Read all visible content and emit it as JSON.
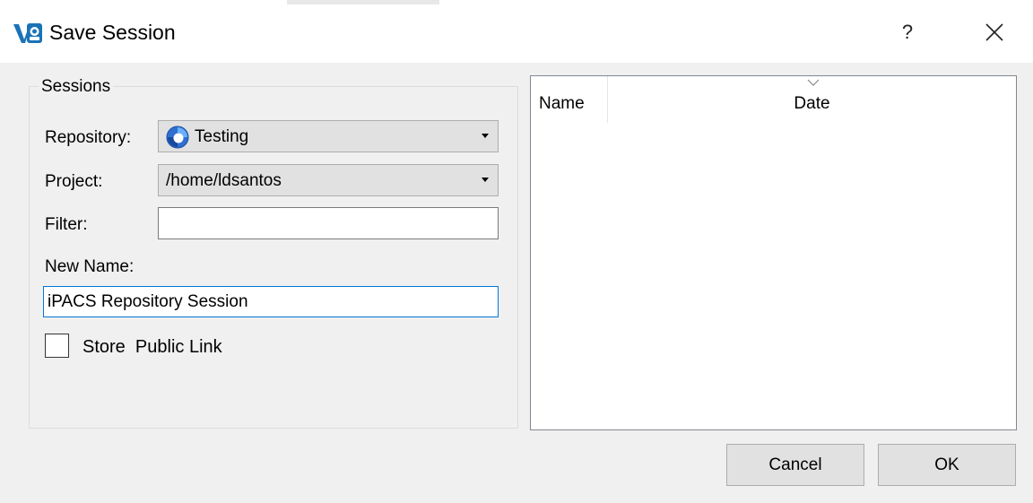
{
  "window": {
    "title": "Save Session",
    "help_label": "?",
    "app_icon": "vsee-app-icon",
    "close_icon": "close-icon"
  },
  "sessions_group": {
    "title": "Sessions",
    "repository": {
      "label": "Repository:",
      "value": "Testing",
      "icon": "repository-icon"
    },
    "project": {
      "label": "Project:",
      "value": "/home/ldsantos"
    },
    "filter": {
      "label": "Filter:",
      "value": ""
    },
    "new_name": {
      "label": "New Name:",
      "value": "iPACS Repository Session"
    },
    "store_public_link": {
      "label": "Store  Public Link",
      "checked": false
    }
  },
  "sessions_table": {
    "columns": [
      "Name",
      "Date"
    ],
    "rows": [],
    "sort_icon": "sort-descending-icon"
  },
  "buttons": {
    "cancel": "Cancel",
    "ok": "OK"
  },
  "colors": {
    "accent": "#0078d7",
    "background": "#f0f0f0",
    "app_icon_blue": "#1a73b8"
  }
}
